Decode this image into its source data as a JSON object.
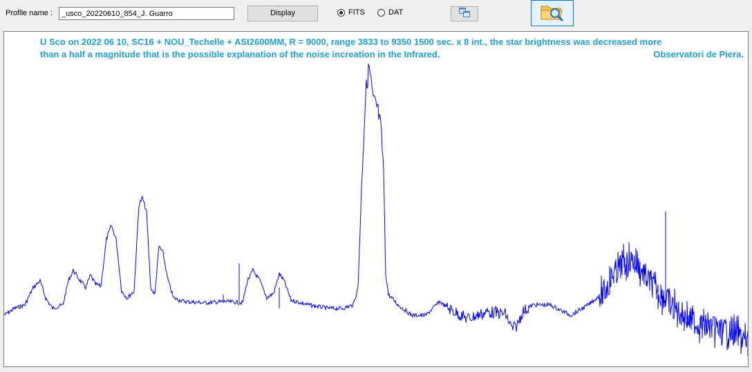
{
  "toolbar": {
    "profile_label": "Profile name :",
    "profile_value": "_usco_20220610_854_J. Guarro",
    "display_label": "Display",
    "format_options": [
      {
        "label": "FITS",
        "selected": true
      },
      {
        "label": "DAT",
        "selected": false
      }
    ],
    "copy_icon": "copy-windows-icon",
    "open_icon": "folder-search-icon"
  },
  "plot": {
    "annotation_line1": "U Sco on 2022 06 10, SC16 + NOU_Techelle + ASI2600MM, R = 9000, range 3833 to 9350 1500 sec. x 8 int., the star brightness was decreased more",
    "annotation_line2": "than a half a magnitude that is the possible explanation of the noise increation in the Infrared.",
    "credit": "Observatori de Piera.",
    "line_color": "#0000ff",
    "annotation_color": "#1e9fd6"
  }
}
